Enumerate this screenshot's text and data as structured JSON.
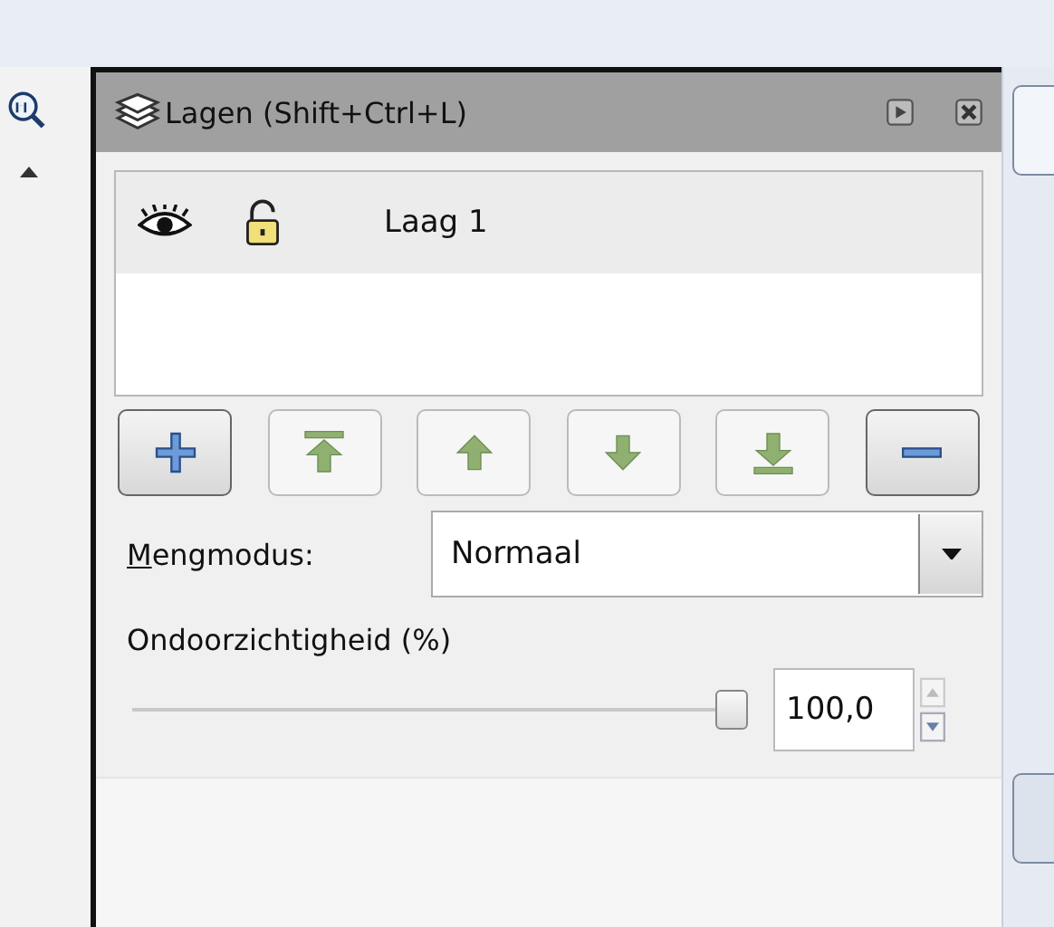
{
  "panel": {
    "title": "Lagen (Shift+Ctrl+L)"
  },
  "layers": [
    {
      "name": "Laag 1",
      "visible": true,
      "locked": false,
      "selected": true
    }
  ],
  "buttons": [
    {
      "kind": "add",
      "disabled": false
    },
    {
      "kind": "top",
      "disabled": true
    },
    {
      "kind": "raise",
      "disabled": true
    },
    {
      "kind": "lower",
      "disabled": true
    },
    {
      "kind": "bottom",
      "disabled": true
    },
    {
      "kind": "remove",
      "disabled": false
    }
  ],
  "blend_mode": {
    "label": "Mengmodus:",
    "value": "Normaal"
  },
  "opacity": {
    "label": "Ondoorzichtigheid (%)",
    "level": 1.0,
    "reading": "100,0"
  }
}
